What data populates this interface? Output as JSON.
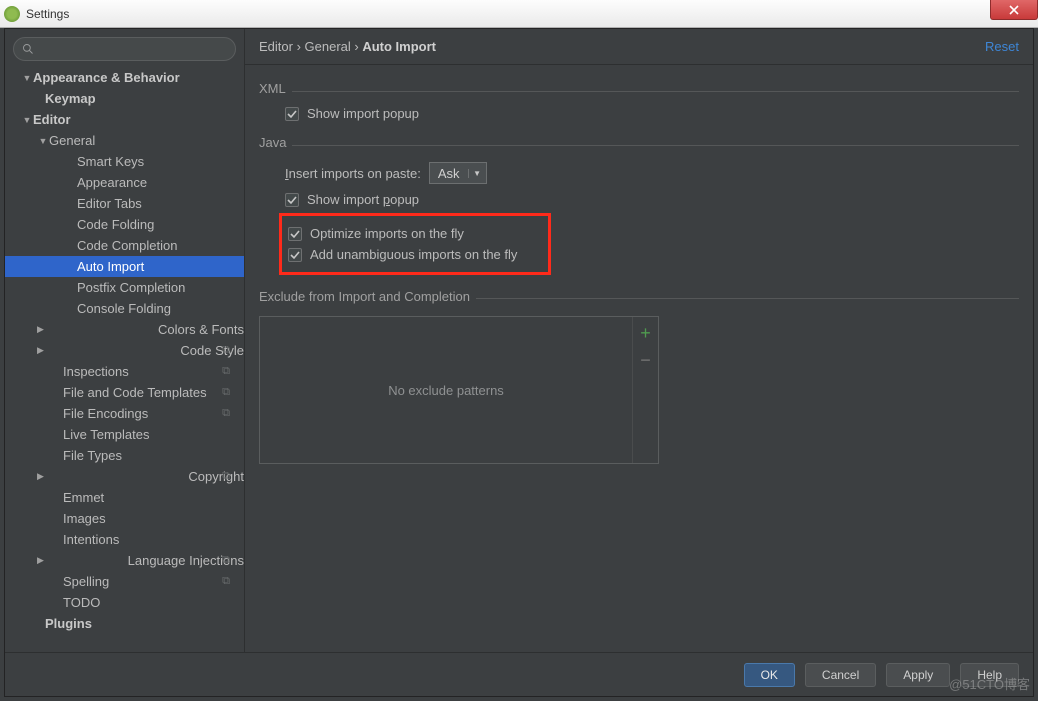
{
  "titlebar": {
    "title": "Settings"
  },
  "search": {
    "placeholder": ""
  },
  "tree": {
    "items": [
      {
        "indent": 16,
        "arrow": "down",
        "label": "Appearance & Behavior",
        "bold": true
      },
      {
        "indent": 28,
        "arrow": "",
        "label": "Keymap",
        "bold": true
      },
      {
        "indent": 16,
        "arrow": "down",
        "label": "Editor",
        "bold": true
      },
      {
        "indent": 32,
        "arrow": "down",
        "label": "General"
      },
      {
        "indent": 60,
        "arrow": "",
        "label": "Smart Keys"
      },
      {
        "indent": 60,
        "arrow": "",
        "label": "Appearance"
      },
      {
        "indent": 60,
        "arrow": "",
        "label": "Editor Tabs"
      },
      {
        "indent": 60,
        "arrow": "",
        "label": "Code Folding"
      },
      {
        "indent": 60,
        "arrow": "",
        "label": "Code Completion"
      },
      {
        "indent": 60,
        "arrow": "",
        "label": "Auto Import",
        "selected": true
      },
      {
        "indent": 60,
        "arrow": "",
        "label": "Postfix Completion"
      },
      {
        "indent": 60,
        "arrow": "",
        "label": "Console Folding"
      },
      {
        "indent": 32,
        "arrow": "right",
        "label": "Colors & Fonts"
      },
      {
        "indent": 32,
        "arrow": "right",
        "label": "Code Style",
        "copy": true
      },
      {
        "indent": 46,
        "arrow": "",
        "label": "Inspections",
        "copy": true
      },
      {
        "indent": 46,
        "arrow": "",
        "label": "File and Code Templates",
        "copy": true
      },
      {
        "indent": 46,
        "arrow": "",
        "label": "File Encodings",
        "copy": true
      },
      {
        "indent": 46,
        "arrow": "",
        "label": "Live Templates"
      },
      {
        "indent": 46,
        "arrow": "",
        "label": "File Types"
      },
      {
        "indent": 32,
        "arrow": "right",
        "label": "Copyright",
        "copy": true
      },
      {
        "indent": 46,
        "arrow": "",
        "label": "Emmet"
      },
      {
        "indent": 46,
        "arrow": "",
        "label": "Images"
      },
      {
        "indent": 46,
        "arrow": "",
        "label": "Intentions"
      },
      {
        "indent": 32,
        "arrow": "right",
        "label": "Language Injections",
        "copy": true
      },
      {
        "indent": 46,
        "arrow": "",
        "label": "Spelling",
        "copy": true
      },
      {
        "indent": 46,
        "arrow": "",
        "label": "TODO"
      },
      {
        "indent": 28,
        "arrow": "",
        "label": "Plugins",
        "bold": true
      }
    ]
  },
  "breadcrumb": {
    "a": "Editor",
    "b": "General",
    "c": "Auto Import"
  },
  "reset_label": "Reset",
  "groups": {
    "xml": "XML",
    "java": "Java",
    "exclude": "Exclude from Import and Completion"
  },
  "xml_show_import": "Show import popup",
  "java": {
    "insert_label": "Insert imports on paste:",
    "insert_value": "Ask",
    "show_popup": "Show import popup",
    "optimize": "Optimize imports on the fly",
    "unambiguous": "Add unambiguous imports on the fly"
  },
  "exclude": {
    "empty": "No exclude patterns"
  },
  "buttons": {
    "ok": "OK",
    "cancel": "Cancel",
    "apply": "Apply",
    "help": "Help"
  },
  "watermark": "@51CTO博客"
}
